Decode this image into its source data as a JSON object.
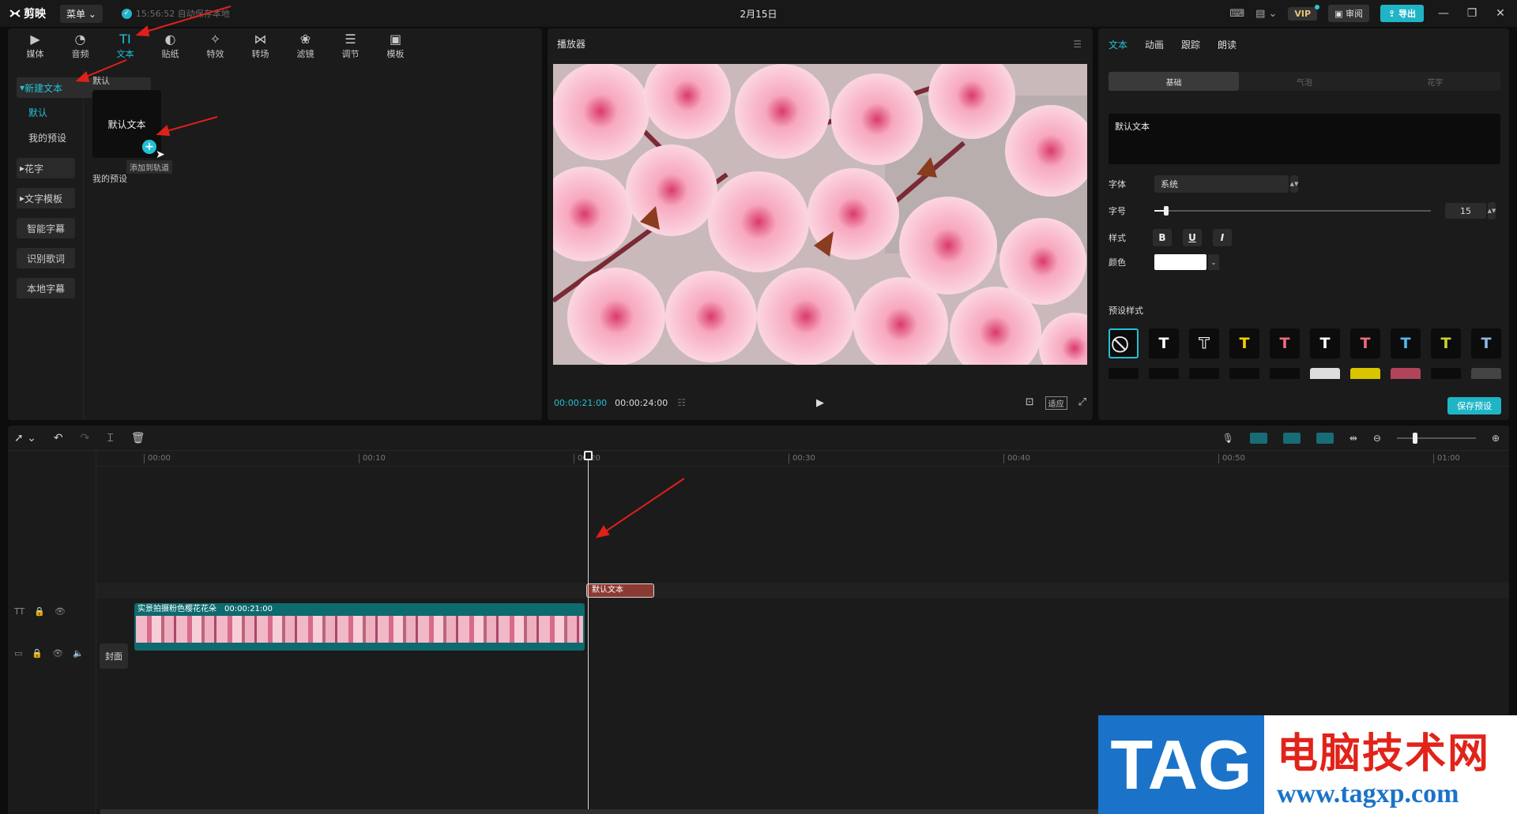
{
  "app": {
    "name": "剪映",
    "menu_label": "菜单",
    "autosave": "15:56:52 自动保存本地",
    "title": "2月15日"
  },
  "titlebar_right": {
    "vip": "VIP",
    "review": "审阅",
    "export": "导出"
  },
  "tools": [
    {
      "label": "媒体",
      "icon": "▶"
    },
    {
      "label": "音频",
      "icon": "◔"
    },
    {
      "label": "文本",
      "icon": "TI"
    },
    {
      "label": "贴纸",
      "icon": "◐"
    },
    {
      "label": "特效",
      "icon": "✧"
    },
    {
      "label": "转场",
      "icon": "⋈"
    },
    {
      "label": "滤镜",
      "icon": "❀"
    },
    {
      "label": "调节",
      "icon": "☰"
    },
    {
      "label": "模板",
      "icon": "▣"
    }
  ],
  "sidebar": {
    "new_text": "新建文本",
    "default": "默认",
    "my_presets": "我的预设",
    "flower_text": "花字",
    "text_template": "文字模板",
    "smart_subtitle": "智能字幕",
    "recognize_lyrics": "识别歌词",
    "local_subtitle": "本地字幕"
  },
  "content": {
    "section_label": "默认",
    "card_label": "默认文本",
    "tooltip": "添加到轨道",
    "my_presets_label": "我的预设"
  },
  "player": {
    "title": "播放器",
    "current_time": "00:00:21:00",
    "total_time": "00:00:24:00",
    "fit_label": "适应"
  },
  "inspector": {
    "tabs": [
      "文本",
      "动画",
      "跟踪",
      "朗读"
    ],
    "subtabs": [
      "基础",
      "气泡",
      "花字"
    ],
    "text_value": "默认文本",
    "font_label": "字体",
    "font_value": "系统",
    "size_label": "字号",
    "size_value": "15",
    "style_label": "样式",
    "bold": "B",
    "underline": "U",
    "italic": "I",
    "color_label": "颜色",
    "color_value": "#ffffff",
    "preset_label": "预设样式",
    "preset_colors": [
      "#ffffff",
      "#ffffff",
      "#f5d000",
      "#f06b80",
      "#ffffff",
      "#f06b80",
      "#55b8f0",
      "#c8d23a",
      "#8fb8e0"
    ],
    "save_preset": "保存预设"
  },
  "timeline": {
    "ticks": [
      "00:00",
      "00:10",
      "00:20",
      "00:30",
      "00:40",
      "00:50",
      "01:00"
    ],
    "text_clip": "默认文本",
    "video_clip_name": "实景拍摄粉色樱花花朵",
    "video_clip_duration": "00:00:21:00",
    "cover_label": "封面"
  },
  "watermark": {
    "tag": "TAG",
    "site_name": "电脑技术网",
    "url": "www.tagxp.com"
  },
  "colors": {
    "accent": "#22c1d6",
    "text_clip": "#8b3a32",
    "video_clip": "#0d6a6e",
    "annotation": "#e0201a"
  }
}
